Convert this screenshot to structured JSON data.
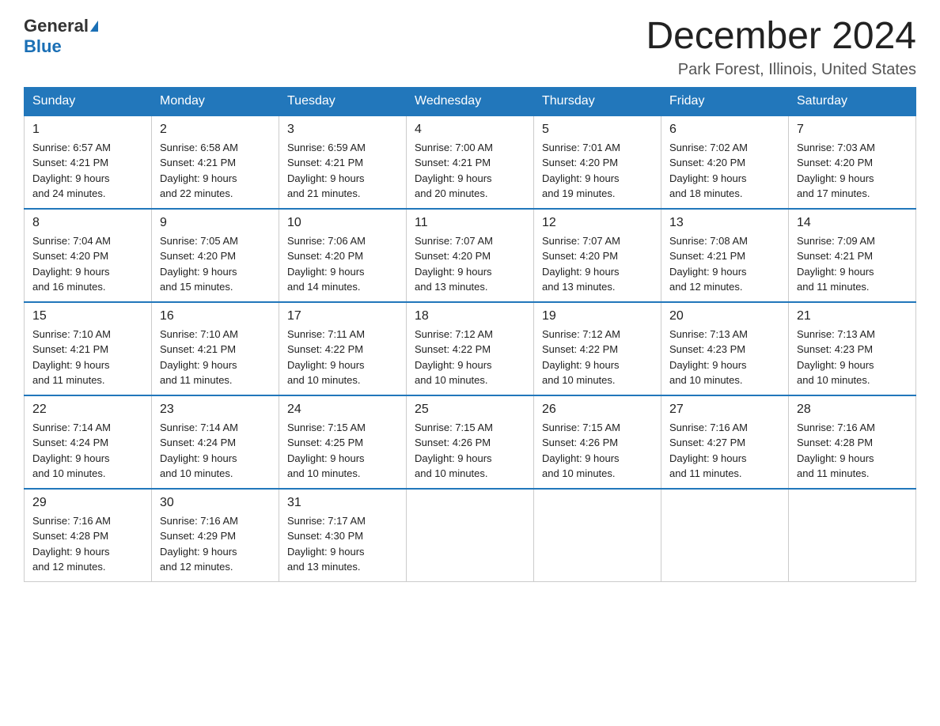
{
  "header": {
    "logo_general": "General",
    "logo_blue": "Blue",
    "month_title": "December 2024",
    "location": "Park Forest, Illinois, United States"
  },
  "days_of_week": [
    "Sunday",
    "Monday",
    "Tuesday",
    "Wednesday",
    "Thursday",
    "Friday",
    "Saturday"
  ],
  "weeks": [
    [
      {
        "day": "1",
        "sunrise": "6:57 AM",
        "sunset": "4:21 PM",
        "daylight": "9 hours and 24 minutes."
      },
      {
        "day": "2",
        "sunrise": "6:58 AM",
        "sunset": "4:21 PM",
        "daylight": "9 hours and 22 minutes."
      },
      {
        "day": "3",
        "sunrise": "6:59 AM",
        "sunset": "4:21 PM",
        "daylight": "9 hours and 21 minutes."
      },
      {
        "day": "4",
        "sunrise": "7:00 AM",
        "sunset": "4:21 PM",
        "daylight": "9 hours and 20 minutes."
      },
      {
        "day": "5",
        "sunrise": "7:01 AM",
        "sunset": "4:20 PM",
        "daylight": "9 hours and 19 minutes."
      },
      {
        "day": "6",
        "sunrise": "7:02 AM",
        "sunset": "4:20 PM",
        "daylight": "9 hours and 18 minutes."
      },
      {
        "day": "7",
        "sunrise": "7:03 AM",
        "sunset": "4:20 PM",
        "daylight": "9 hours and 17 minutes."
      }
    ],
    [
      {
        "day": "8",
        "sunrise": "7:04 AM",
        "sunset": "4:20 PM",
        "daylight": "9 hours and 16 minutes."
      },
      {
        "day": "9",
        "sunrise": "7:05 AM",
        "sunset": "4:20 PM",
        "daylight": "9 hours and 15 minutes."
      },
      {
        "day": "10",
        "sunrise": "7:06 AM",
        "sunset": "4:20 PM",
        "daylight": "9 hours and 14 minutes."
      },
      {
        "day": "11",
        "sunrise": "7:07 AM",
        "sunset": "4:20 PM",
        "daylight": "9 hours and 13 minutes."
      },
      {
        "day": "12",
        "sunrise": "7:07 AM",
        "sunset": "4:20 PM",
        "daylight": "9 hours and 13 minutes."
      },
      {
        "day": "13",
        "sunrise": "7:08 AM",
        "sunset": "4:21 PM",
        "daylight": "9 hours and 12 minutes."
      },
      {
        "day": "14",
        "sunrise": "7:09 AM",
        "sunset": "4:21 PM",
        "daylight": "9 hours and 11 minutes."
      }
    ],
    [
      {
        "day": "15",
        "sunrise": "7:10 AM",
        "sunset": "4:21 PM",
        "daylight": "9 hours and 11 minutes."
      },
      {
        "day": "16",
        "sunrise": "7:10 AM",
        "sunset": "4:21 PM",
        "daylight": "9 hours and 11 minutes."
      },
      {
        "day": "17",
        "sunrise": "7:11 AM",
        "sunset": "4:22 PM",
        "daylight": "9 hours and 10 minutes."
      },
      {
        "day": "18",
        "sunrise": "7:12 AM",
        "sunset": "4:22 PM",
        "daylight": "9 hours and 10 minutes."
      },
      {
        "day": "19",
        "sunrise": "7:12 AM",
        "sunset": "4:22 PM",
        "daylight": "9 hours and 10 minutes."
      },
      {
        "day": "20",
        "sunrise": "7:13 AM",
        "sunset": "4:23 PM",
        "daylight": "9 hours and 10 minutes."
      },
      {
        "day": "21",
        "sunrise": "7:13 AM",
        "sunset": "4:23 PM",
        "daylight": "9 hours and 10 minutes."
      }
    ],
    [
      {
        "day": "22",
        "sunrise": "7:14 AM",
        "sunset": "4:24 PM",
        "daylight": "9 hours and 10 minutes."
      },
      {
        "day": "23",
        "sunrise": "7:14 AM",
        "sunset": "4:24 PM",
        "daylight": "9 hours and 10 minutes."
      },
      {
        "day": "24",
        "sunrise": "7:15 AM",
        "sunset": "4:25 PM",
        "daylight": "9 hours and 10 minutes."
      },
      {
        "day": "25",
        "sunrise": "7:15 AM",
        "sunset": "4:26 PM",
        "daylight": "9 hours and 10 minutes."
      },
      {
        "day": "26",
        "sunrise": "7:15 AM",
        "sunset": "4:26 PM",
        "daylight": "9 hours and 10 minutes."
      },
      {
        "day": "27",
        "sunrise": "7:16 AM",
        "sunset": "4:27 PM",
        "daylight": "9 hours and 11 minutes."
      },
      {
        "day": "28",
        "sunrise": "7:16 AM",
        "sunset": "4:28 PM",
        "daylight": "9 hours and 11 minutes."
      }
    ],
    [
      {
        "day": "29",
        "sunrise": "7:16 AM",
        "sunset": "4:28 PM",
        "daylight": "9 hours and 12 minutes."
      },
      {
        "day": "30",
        "sunrise": "7:16 AM",
        "sunset": "4:29 PM",
        "daylight": "9 hours and 12 minutes."
      },
      {
        "day": "31",
        "sunrise": "7:17 AM",
        "sunset": "4:30 PM",
        "daylight": "9 hours and 13 minutes."
      },
      null,
      null,
      null,
      null
    ]
  ],
  "labels": {
    "sunrise": "Sunrise:",
    "sunset": "Sunset:",
    "daylight": "Daylight:"
  }
}
